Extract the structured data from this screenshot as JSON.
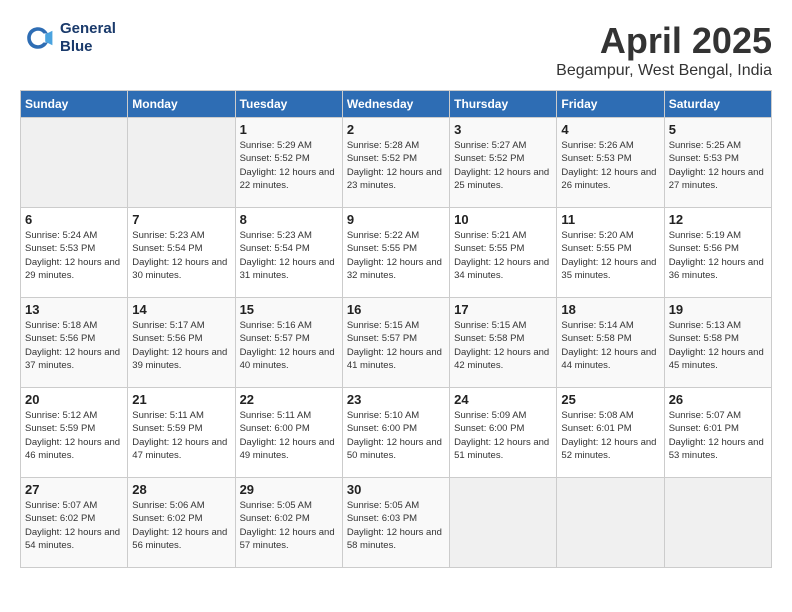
{
  "header": {
    "logo_line1": "General",
    "logo_line2": "Blue",
    "month_year": "April 2025",
    "location": "Begampur, West Bengal, India"
  },
  "weekdays": [
    "Sunday",
    "Monday",
    "Tuesday",
    "Wednesday",
    "Thursday",
    "Friday",
    "Saturday"
  ],
  "weeks": [
    [
      {
        "day": "",
        "sunrise": "",
        "sunset": "",
        "daylight": "",
        "empty": true
      },
      {
        "day": "",
        "sunrise": "",
        "sunset": "",
        "daylight": "",
        "empty": true
      },
      {
        "day": "1",
        "sunrise": "Sunrise: 5:29 AM",
        "sunset": "Sunset: 5:52 PM",
        "daylight": "Daylight: 12 hours and 22 minutes."
      },
      {
        "day": "2",
        "sunrise": "Sunrise: 5:28 AM",
        "sunset": "Sunset: 5:52 PM",
        "daylight": "Daylight: 12 hours and 23 minutes."
      },
      {
        "day": "3",
        "sunrise": "Sunrise: 5:27 AM",
        "sunset": "Sunset: 5:52 PM",
        "daylight": "Daylight: 12 hours and 25 minutes."
      },
      {
        "day": "4",
        "sunrise": "Sunrise: 5:26 AM",
        "sunset": "Sunset: 5:53 PM",
        "daylight": "Daylight: 12 hours and 26 minutes."
      },
      {
        "day": "5",
        "sunrise": "Sunrise: 5:25 AM",
        "sunset": "Sunset: 5:53 PM",
        "daylight": "Daylight: 12 hours and 27 minutes."
      }
    ],
    [
      {
        "day": "6",
        "sunrise": "Sunrise: 5:24 AM",
        "sunset": "Sunset: 5:53 PM",
        "daylight": "Daylight: 12 hours and 29 minutes."
      },
      {
        "day": "7",
        "sunrise": "Sunrise: 5:23 AM",
        "sunset": "Sunset: 5:54 PM",
        "daylight": "Daylight: 12 hours and 30 minutes."
      },
      {
        "day": "8",
        "sunrise": "Sunrise: 5:23 AM",
        "sunset": "Sunset: 5:54 PM",
        "daylight": "Daylight: 12 hours and 31 minutes."
      },
      {
        "day": "9",
        "sunrise": "Sunrise: 5:22 AM",
        "sunset": "Sunset: 5:55 PM",
        "daylight": "Daylight: 12 hours and 32 minutes."
      },
      {
        "day": "10",
        "sunrise": "Sunrise: 5:21 AM",
        "sunset": "Sunset: 5:55 PM",
        "daylight": "Daylight: 12 hours and 34 minutes."
      },
      {
        "day": "11",
        "sunrise": "Sunrise: 5:20 AM",
        "sunset": "Sunset: 5:55 PM",
        "daylight": "Daylight: 12 hours and 35 minutes."
      },
      {
        "day": "12",
        "sunrise": "Sunrise: 5:19 AM",
        "sunset": "Sunset: 5:56 PM",
        "daylight": "Daylight: 12 hours and 36 minutes."
      }
    ],
    [
      {
        "day": "13",
        "sunrise": "Sunrise: 5:18 AM",
        "sunset": "Sunset: 5:56 PM",
        "daylight": "Daylight: 12 hours and 37 minutes."
      },
      {
        "day": "14",
        "sunrise": "Sunrise: 5:17 AM",
        "sunset": "Sunset: 5:56 PM",
        "daylight": "Daylight: 12 hours and 39 minutes."
      },
      {
        "day": "15",
        "sunrise": "Sunrise: 5:16 AM",
        "sunset": "Sunset: 5:57 PM",
        "daylight": "Daylight: 12 hours and 40 minutes."
      },
      {
        "day": "16",
        "sunrise": "Sunrise: 5:15 AM",
        "sunset": "Sunset: 5:57 PM",
        "daylight": "Daylight: 12 hours and 41 minutes."
      },
      {
        "day": "17",
        "sunrise": "Sunrise: 5:15 AM",
        "sunset": "Sunset: 5:58 PM",
        "daylight": "Daylight: 12 hours and 42 minutes."
      },
      {
        "day": "18",
        "sunrise": "Sunrise: 5:14 AM",
        "sunset": "Sunset: 5:58 PM",
        "daylight": "Daylight: 12 hours and 44 minutes."
      },
      {
        "day": "19",
        "sunrise": "Sunrise: 5:13 AM",
        "sunset": "Sunset: 5:58 PM",
        "daylight": "Daylight: 12 hours and 45 minutes."
      }
    ],
    [
      {
        "day": "20",
        "sunrise": "Sunrise: 5:12 AM",
        "sunset": "Sunset: 5:59 PM",
        "daylight": "Daylight: 12 hours and 46 minutes."
      },
      {
        "day": "21",
        "sunrise": "Sunrise: 5:11 AM",
        "sunset": "Sunset: 5:59 PM",
        "daylight": "Daylight: 12 hours and 47 minutes."
      },
      {
        "day": "22",
        "sunrise": "Sunrise: 5:11 AM",
        "sunset": "Sunset: 6:00 PM",
        "daylight": "Daylight: 12 hours and 49 minutes."
      },
      {
        "day": "23",
        "sunrise": "Sunrise: 5:10 AM",
        "sunset": "Sunset: 6:00 PM",
        "daylight": "Daylight: 12 hours and 50 minutes."
      },
      {
        "day": "24",
        "sunrise": "Sunrise: 5:09 AM",
        "sunset": "Sunset: 6:00 PM",
        "daylight": "Daylight: 12 hours and 51 minutes."
      },
      {
        "day": "25",
        "sunrise": "Sunrise: 5:08 AM",
        "sunset": "Sunset: 6:01 PM",
        "daylight": "Daylight: 12 hours and 52 minutes."
      },
      {
        "day": "26",
        "sunrise": "Sunrise: 5:07 AM",
        "sunset": "Sunset: 6:01 PM",
        "daylight": "Daylight: 12 hours and 53 minutes."
      }
    ],
    [
      {
        "day": "27",
        "sunrise": "Sunrise: 5:07 AM",
        "sunset": "Sunset: 6:02 PM",
        "daylight": "Daylight: 12 hours and 54 minutes."
      },
      {
        "day": "28",
        "sunrise": "Sunrise: 5:06 AM",
        "sunset": "Sunset: 6:02 PM",
        "daylight": "Daylight: 12 hours and 56 minutes."
      },
      {
        "day": "29",
        "sunrise": "Sunrise: 5:05 AM",
        "sunset": "Sunset: 6:02 PM",
        "daylight": "Daylight: 12 hours and 57 minutes."
      },
      {
        "day": "30",
        "sunrise": "Sunrise: 5:05 AM",
        "sunset": "Sunset: 6:03 PM",
        "daylight": "Daylight: 12 hours and 58 minutes."
      },
      {
        "day": "",
        "sunrise": "",
        "sunset": "",
        "daylight": "",
        "empty": true
      },
      {
        "day": "",
        "sunrise": "",
        "sunset": "",
        "daylight": "",
        "empty": true
      },
      {
        "day": "",
        "sunrise": "",
        "sunset": "",
        "daylight": "",
        "empty": true
      }
    ]
  ]
}
